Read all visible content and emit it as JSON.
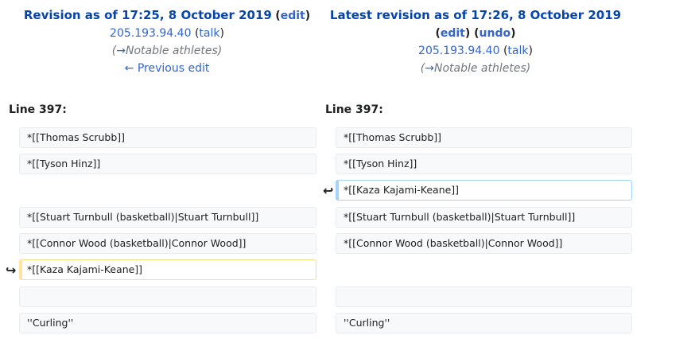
{
  "left_header": {
    "title": "Revision as of 17:25, 8 October 2019",
    "edit_link": "edit",
    "user": "205.193.94.40",
    "talk_link": "talk",
    "summary_arrow": "→",
    "summary": "Notable athletes",
    "prev_link": "← Previous edit"
  },
  "right_header": {
    "title": "Latest revision as of 17:26, 8 October 2019",
    "edit_link": "edit",
    "undo_link": "undo",
    "user": "205.193.94.40",
    "talk_link": "talk",
    "summary_arrow": "→",
    "summary": "Notable athletes"
  },
  "diff": {
    "left_line": "Line 397:",
    "right_line": "Line 397:",
    "left_rows": [
      "*[[Thomas Scrubb]]",
      "*[[Tyson Hinz]]",
      "*[[Stuart Turnbull (basketball)|Stuart Turnbull]]",
      "*[[Connor Wood (basketball)|Connor Wood]]",
      "*[[Kaza Kajami-Keane]]",
      "",
      "''Curling''"
    ],
    "right_rows": [
      "*[[Thomas Scrubb]]",
      "*[[Tyson Hinz]]",
      "*[[Kaza Kajami-Keane]]",
      "*[[Stuart Turnbull (basketball)|Stuart Turnbull]]",
      "*[[Connor Wood (basketball)|Connor Wood]]",
      "",
      "''Curling''"
    ],
    "moved_marker_left": "↪",
    "moved_marker_right": "↩"
  }
}
